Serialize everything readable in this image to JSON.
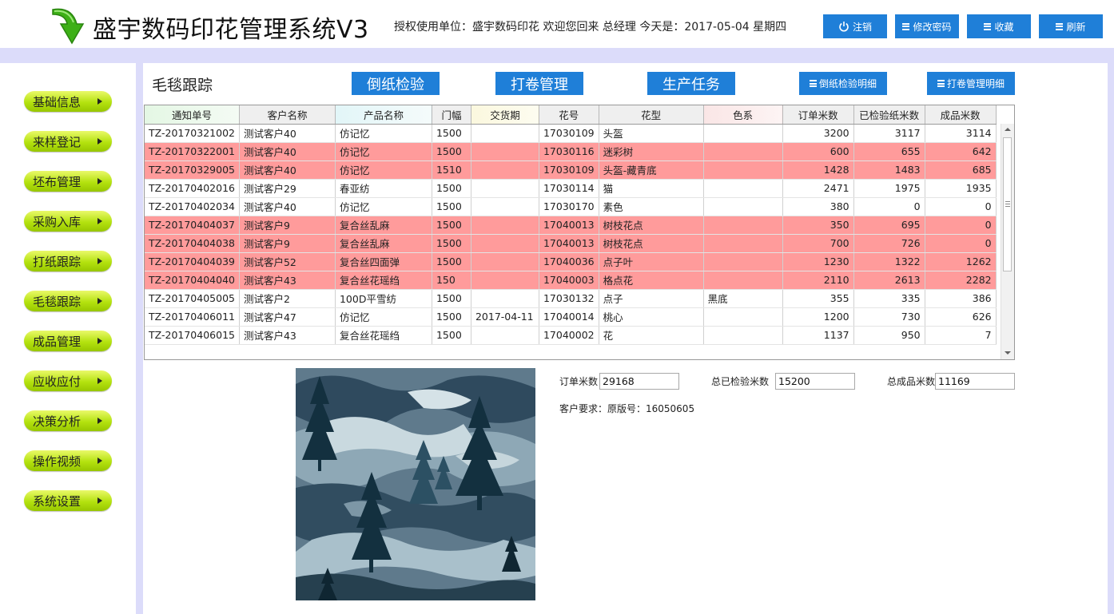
{
  "header": {
    "app_title": "盛宇数码印花管理系统V3",
    "welcome": "授权使用单位：盛宇数码印花 欢迎您回来 总经理 今天是：2017-05-04 星期四",
    "buttons": {
      "logout": "注销",
      "change_password": "修改密码",
      "favorites": "收藏",
      "refresh": "刷新"
    }
  },
  "sidebar": {
    "items": [
      "基础信息",
      "来样登记",
      "坯布管理",
      "采购入库",
      "打纸跟踪",
      "毛毯跟踪",
      "成品管理",
      "应收应付",
      "决策分析",
      "操作视频",
      "系统设置"
    ]
  },
  "main": {
    "title": "毛毯跟踪",
    "actions": {
      "paper_inspection": "倒纸检验",
      "roll_management": "打卷管理",
      "production_task": "生产任务",
      "paper_inspection_detail": "倒纸检验明细",
      "roll_management_detail": "打卷管理明细"
    }
  },
  "table": {
    "columns": [
      "通知单号",
      "客户名称",
      "产品名称",
      "门幅",
      "交货期",
      "花号",
      "花型",
      "色系",
      "订单米数",
      "已检验纸米数",
      "成品米数"
    ],
    "rows": [
      {
        "cells": [
          "TZ-20170321002",
          "测试客户40",
          "仿记忆",
          "1500",
          "",
          "17030109",
          "头盔",
          "",
          "3200",
          "3117",
          "3114"
        ],
        "highlight": false
      },
      {
        "cells": [
          "TZ-20170322001",
          "测试客户40",
          "仿记忆",
          "1500",
          "",
          "17030116",
          "迷彩树",
          "",
          "600",
          "655",
          "642"
        ],
        "highlight": true
      },
      {
        "cells": [
          "TZ-20170329005",
          "测试客户40",
          "仿记忆",
          "1510",
          "",
          "17030109",
          "头盔-藏青底",
          "",
          "1428",
          "1483",
          "685"
        ],
        "highlight": true
      },
      {
        "cells": [
          "TZ-20170402016",
          "测试客户29",
          "春亚纺",
          "1500",
          "",
          "17030114",
          "猫",
          "",
          "2471",
          "1975",
          "1935"
        ],
        "highlight": false
      },
      {
        "cells": [
          "TZ-20170402034",
          "测试客户40",
          "仿记忆",
          "1500",
          "",
          "17030170",
          "素色",
          "",
          "380",
          "0",
          "0"
        ],
        "highlight": false
      },
      {
        "cells": [
          "TZ-20170404037",
          "测试客户9",
          "复合丝乱麻",
          "1500",
          "",
          "17040013",
          "树枝花点",
          "",
          "350",
          "695",
          "0"
        ],
        "highlight": true
      },
      {
        "cells": [
          "TZ-20170404038",
          "测试客户9",
          "复合丝乱麻",
          "1500",
          "",
          "17040013",
          "树枝花点",
          "",
          "700",
          "726",
          "0"
        ],
        "highlight": true
      },
      {
        "cells": [
          "TZ-20170404039",
          "测试客户52",
          "复合丝四面弹",
          "1500",
          "",
          "17040036",
          "点子叶",
          "",
          "1230",
          "1322",
          "1262"
        ],
        "highlight": true
      },
      {
        "cells": [
          "TZ-20170404040",
          "测试客户43",
          "复合丝花瑶绉",
          "150",
          "",
          "17040003",
          "格点花",
          "",
          "2110",
          "2613",
          "2282"
        ],
        "highlight": true
      },
      {
        "cells": [
          "TZ-20170405005",
          "测试客户2",
          "100D平雪纺",
          "1500",
          "",
          "17030132",
          "点子",
          "黑底",
          "355",
          "335",
          "386"
        ],
        "highlight": false
      },
      {
        "cells": [
          "TZ-20170406011",
          "测试客户47",
          "仿记忆",
          "1500",
          "2017-04-11",
          "17040014",
          "桃心",
          "",
          "1200",
          "730",
          "626"
        ],
        "highlight": false
      },
      {
        "cells": [
          "TZ-20170406015",
          "测试客户43",
          "复合丝花瑶绉",
          "1500",
          "",
          "17040002",
          "花",
          "",
          "1137",
          "950",
          "7"
        ],
        "highlight": false
      }
    ]
  },
  "summary": {
    "order_meters_label": "订单米数",
    "order_meters_value": "29168",
    "inspected_label": "总已检验米数",
    "inspected_value": "15200",
    "finished_label": "总成品米数",
    "finished_value": "11169",
    "customer_requirement": "客户要求：原版号：16050605"
  },
  "colors": {
    "accent_blue": "#1f7fd8",
    "highlight_row": "#ff9b9b",
    "sidebar_button": "#b4e20f",
    "stripe": "#dcdcfa"
  }
}
